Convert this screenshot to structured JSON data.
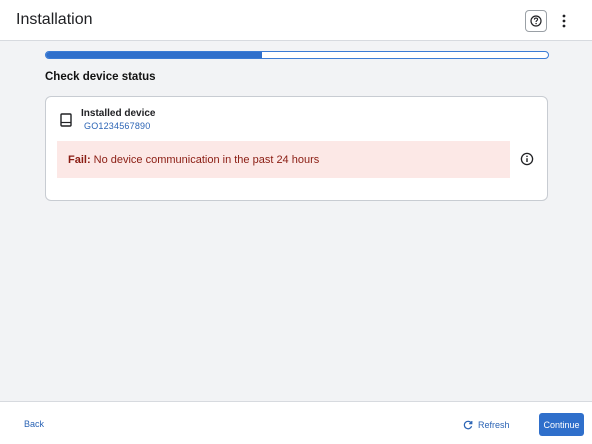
{
  "header": {
    "title": "Installation",
    "help_icon": "help-circle-icon",
    "more_icon": "more-vertical-icon"
  },
  "progress": {
    "fraction": 0.43
  },
  "section": {
    "title": "Check device status"
  },
  "device": {
    "icon": "device-icon",
    "name": "Installed device",
    "id": "GO1234567890"
  },
  "alert": {
    "label": "Fail:",
    "message": "No device communication in the past 24 hours",
    "info_icon": "info-icon"
  },
  "footer": {
    "back_label": "Back",
    "refresh_label": "Refresh",
    "refresh_icon": "refresh-icon",
    "continue_label": "Continue"
  },
  "colors": {
    "accent": "#2f6fcb",
    "link": "#2b64b5",
    "alert_bg": "#fce8e6",
    "alert_text": "#8a1c12"
  }
}
